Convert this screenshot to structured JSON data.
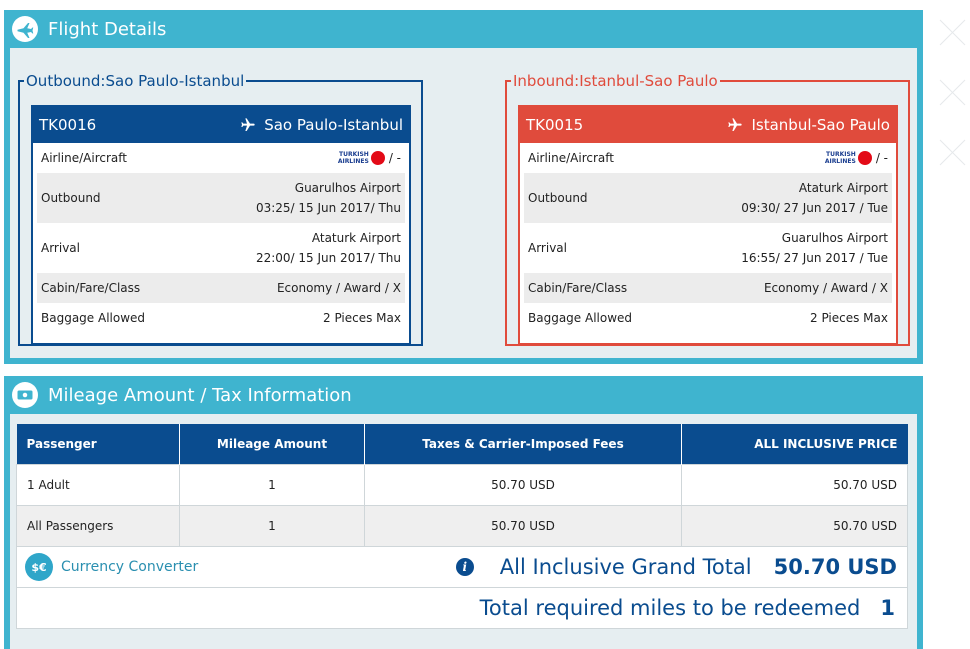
{
  "flight_details": {
    "title": "Flight Details",
    "outbound": {
      "legend": "Outbound:Sao Paulo-Istanbul",
      "flight_no": "TK0016",
      "route": "Sao Paulo-Istanbul",
      "airline_logo_text": "TURKISH AIRLINES",
      "rows": {
        "airline_label": "Airline/Aircraft",
        "airline_suffix": "/ -",
        "outbound_label": "Outbound",
        "outbound_airport": "Guarulhos Airport",
        "outbound_time": "03:25/ 15 Jun 2017/ Thu",
        "arrival_label": "Arrival",
        "arrival_airport": "Ataturk Airport",
        "arrival_time": "22:00/ 15 Jun 2017/ Thu",
        "cabin_label": "Cabin/Fare/Class",
        "cabin_value": "Economy / Award / X",
        "baggage_label": "Baggage Allowed",
        "baggage_value": "2 Pieces Max"
      }
    },
    "inbound": {
      "legend": "Inbound:Istanbul-Sao Paulo",
      "flight_no": "TK0015",
      "route": "Istanbul-Sao Paulo",
      "airline_logo_text": "TURKISH AIRLINES",
      "rows": {
        "airline_label": "Airline/Aircraft",
        "airline_suffix": "/ -",
        "outbound_label": "Outbound",
        "outbound_airport": "Ataturk Airport",
        "outbound_time": "09:30/ 27 Jun 2017 / Tue",
        "arrival_label": "Arrival",
        "arrival_airport": "Guarulhos Airport",
        "arrival_time": "16:55/ 27 Jun 2017 / Tue",
        "cabin_label": "Cabin/Fare/Class",
        "cabin_value": "Economy / Award / X",
        "baggage_label": "Baggage Allowed",
        "baggage_value": "2 Pieces Max"
      }
    }
  },
  "mileage": {
    "title": "Mileage Amount / Tax Information",
    "columns": [
      "Passenger",
      "Mileage Amount",
      "Taxes & Carrier-Imposed Fees",
      "ALL INCLUSIVE PRICE"
    ],
    "rows": [
      {
        "passenger": "1 Adult",
        "miles": "1",
        "taxes": "50.70 USD",
        "price": "50.70 USD"
      },
      {
        "passenger": "All Passengers",
        "miles": "1",
        "taxes": "50.70 USD",
        "price": "50.70 USD"
      }
    ],
    "converter_label": "Currency Converter",
    "converter_icon_text": "$€",
    "info_icon_text": "i",
    "grand_total_label": "All Inclusive Grand Total",
    "grand_total_value": "50.70 USD",
    "miles_label": "Total required miles to be redeemed",
    "miles_value": "1"
  },
  "colors": {
    "panel": "#3fb4cf",
    "outbound_accent": "#0a4c8f",
    "inbound_accent": "#e04b3c"
  },
  "icons": [
    "plane-outline-icon",
    "money-icon",
    "plane-icon",
    "currency-converter-icon",
    "info-icon"
  ]
}
